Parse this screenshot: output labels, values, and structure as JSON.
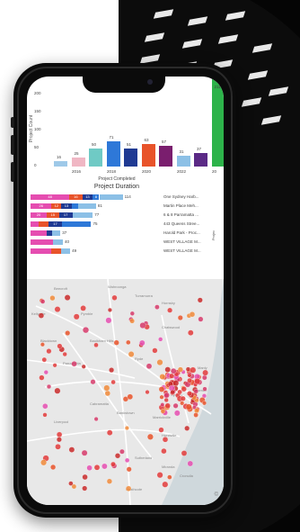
{
  "top_chart": {
    "ylabel": "Project Count",
    "xlabel": "Project Completed",
    "yticks": [
      "200",
      "150",
      "100",
      "50",
      "0"
    ],
    "years": [
      "2016",
      "2018",
      "2020",
      "2022",
      "20"
    ],
    "bars": [
      {
        "label": "16",
        "value": 16,
        "color": "#9ec9e8"
      },
      {
        "label": "25",
        "value": 25,
        "color": "#f0b7c4"
      },
      {
        "label": "50",
        "value": 50,
        "color": "#6fcac5"
      },
      {
        "label": "71",
        "value": 71,
        "color": "#2e78d8"
      },
      {
        "label": "51",
        "value": 51,
        "color": "#1f3a93"
      },
      {
        "label": "63",
        "value": 63,
        "color": "#e8532a"
      },
      {
        "label": "57",
        "value": 57,
        "color": "#7a1e6e"
      },
      {
        "label": "31",
        "value": 31,
        "color": "#8cc0e6"
      },
      {
        "label": "37",
        "value": 37,
        "color": "#5b2a86"
      },
      {
        "label": "211",
        "value": 211,
        "color": "#2db34a"
      }
    ]
  },
  "duration_chart": {
    "title": "Project Duration",
    "side_label": "Projec",
    "rows": [
      {
        "name": "One Sydney Harb...",
        "total": "114",
        "segments": [
          {
            "v": 48,
            "c": "#e54db0",
            "t": "48"
          },
          {
            "v": 16,
            "c": "#e8532a",
            "t": "16"
          },
          {
            "v": 13,
            "c": "#1f3a93",
            "t": "13"
          },
          {
            "v": 8,
            "c": "#2e78d8",
            "t": "8"
          },
          {
            "v": 29,
            "c": "#8cc0e6",
            "t": ""
          }
        ]
      },
      {
        "name": "Martin Place Meh...",
        "total": "81",
        "segments": [
          {
            "v": 26,
            "c": "#e54db0",
            "t": "26"
          },
          {
            "v": 12,
            "c": "#e8532a",
            "t": "12"
          },
          {
            "v": 13,
            "c": "#1f3a93",
            "t": "13"
          },
          {
            "v": 8,
            "c": "#2e78d8",
            "t": ""
          },
          {
            "v": 22,
            "c": "#8cc0e6",
            "t": ""
          }
        ]
      },
      {
        "name": "6 & 8 Parramatta ...",
        "total": "77",
        "segments": [
          {
            "v": 20,
            "c": "#e54db0",
            "t": "20"
          },
          {
            "v": 15,
            "c": "#e8532a",
            "t": "15"
          },
          {
            "v": 17,
            "c": "#1f3a93",
            "t": "17"
          },
          {
            "v": 25,
            "c": "#8cc0e6",
            "t": ""
          }
        ]
      },
      {
        "name": "443 Queens Stree...",
        "total": "75",
        "segments": [
          {
            "v": 10,
            "c": "#e54db0",
            "t": ""
          },
          {
            "v": 12,
            "c": "#e8532a",
            "t": ""
          },
          {
            "v": 17,
            "c": "#1f3a93",
            "t": "17"
          },
          {
            "v": 36,
            "c": "#2e78d8",
            "t": ""
          }
        ]
      },
      {
        "name": "Harold Park - Proc...",
        "total": "37",
        "segments": [
          {
            "v": 20,
            "c": "#e54db0",
            "t": ""
          },
          {
            "v": 7,
            "c": "#1f3a93",
            "t": ""
          },
          {
            "v": 10,
            "c": "#8cc0e6",
            "t": ""
          }
        ]
      },
      {
        "name": "WEST VILLAGE M...",
        "total": "40",
        "segments": [
          {
            "v": 28,
            "c": "#e54db0",
            "t": ""
          },
          {
            "v": 12,
            "c": "#8cc0e6",
            "t": ""
          }
        ]
      },
      {
        "name": "WEST VILLAGE M...",
        "total": "49",
        "segments": [
          {
            "v": 26,
            "c": "#e54db0",
            "t": ""
          },
          {
            "v": 12,
            "c": "#e8532a",
            "t": ""
          },
          {
            "v": 11,
            "c": "#8cc0e6",
            "t": ""
          }
        ]
      }
    ]
  },
  "map": {
    "places": [
      "Beecroft",
      "Wahroonga",
      "Turramurra",
      "Hornsby",
      "Pymble",
      "Chatswood",
      "Parramatta",
      "Liverpool",
      "Sydney",
      "Manly",
      "Cabramatta",
      "Bankstown",
      "Hurstville",
      "Cronulla",
      "Blacktown",
      "Baulkham Hills",
      "Ryde",
      "Mosman",
      "Sutherland",
      "Miranda",
      "Heathcote",
      "Kellyville",
      "Marrickville"
    ],
    "attribution": "©"
  }
}
